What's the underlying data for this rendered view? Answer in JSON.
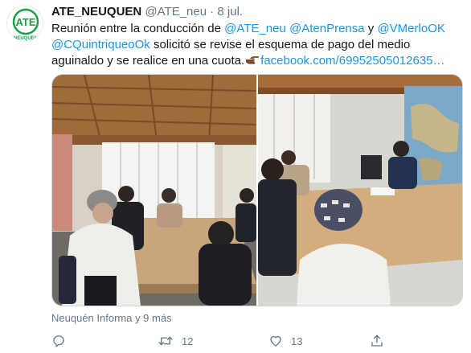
{
  "tweet": {
    "author_name": "ATE_NEUQUEN",
    "handle": "@ATE_neu",
    "separator": "·",
    "date": "8 jul.",
    "avatar": {
      "icon": "ate-logo",
      "logo_text": "ATE",
      "logo_subtext": "NEUQUEN",
      "color": "#1a9e4a"
    },
    "text": {
      "part1": "Reunión entre la conducción de ",
      "mention1": "@ATE_neu",
      "sp1": " ",
      "mention2": "@AtenPrensa",
      "part2": " y ",
      "mention3": "@VMerloOK",
      "sp2": " ",
      "mention4": "@CQuintriqueoOk",
      "part3": " solicitó se revise el esquema de pago del medio aguinaldo y se realice en una cuota.",
      "emoji": "pointing-hand-emoji",
      "link": "facebook.com/69952505012635…"
    },
    "media": {
      "photo_left": {
        "icon": "meeting-photo-1"
      },
      "photo_right": {
        "icon": "meeting-photo-2"
      }
    },
    "tagged": "Neuquén Informa y 9 más",
    "actions": {
      "reply": {
        "icon": "reply-icon",
        "count": ""
      },
      "retweet": {
        "icon": "retweet-icon",
        "count": "12"
      },
      "like": {
        "icon": "heart-icon",
        "count": "13"
      },
      "share": {
        "icon": "share-icon"
      }
    },
    "colors": {
      "link": "#1b95e0",
      "secondary": "#657786",
      "text": "#14171a"
    }
  }
}
